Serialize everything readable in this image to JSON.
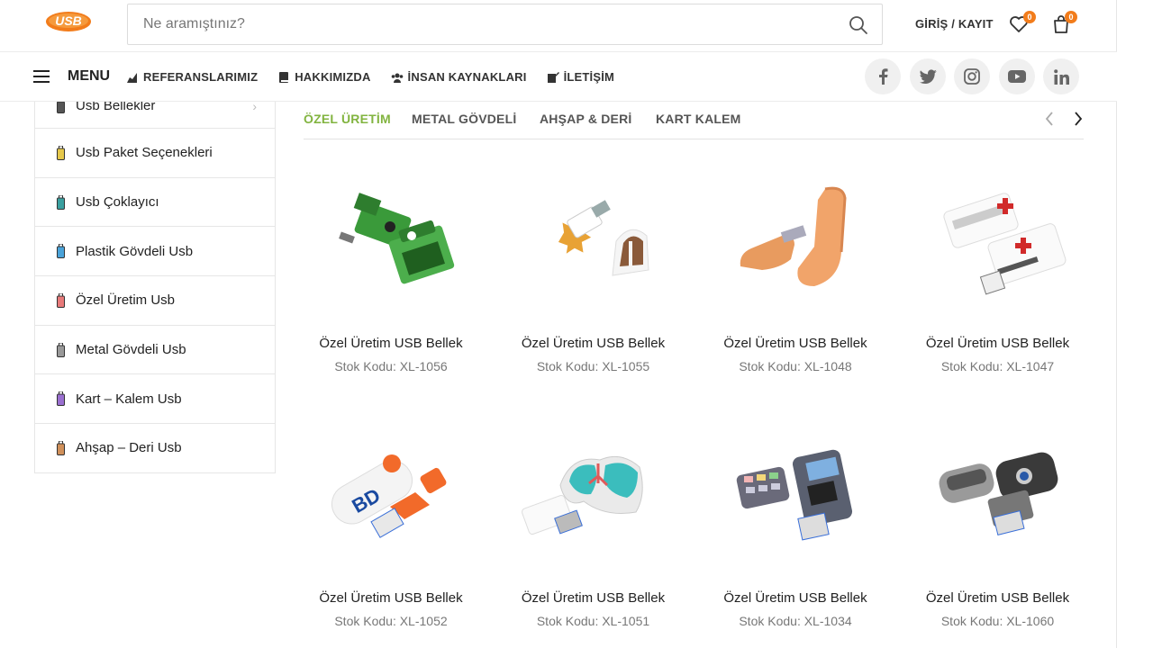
{
  "header": {
    "logo_text": "USB",
    "search_placeholder": "Ne aramıştınız?",
    "login_label": "GİRİŞ / KAYIT",
    "wishlist_count": "0",
    "cart_count": "0"
  },
  "nav": {
    "menu_label": "MENU",
    "links": [
      {
        "label": "REFERANSLARIMIZ",
        "icon": "chart-icon"
      },
      {
        "label": "HAKKIMIZDA",
        "icon": "book-icon"
      },
      {
        "label": "İNSAN KAYNAKLARI",
        "icon": "users-icon"
      },
      {
        "label": "İLETİŞİM",
        "icon": "edit-icon"
      }
    ],
    "socials": [
      {
        "label": "f",
        "icon": "facebook-icon"
      },
      {
        "label": "t",
        "icon": "twitter-icon"
      },
      {
        "label": "ig",
        "icon": "instagram-icon"
      },
      {
        "label": "yt",
        "icon": "youtube-icon"
      },
      {
        "label": "in",
        "icon": "linkedin-icon"
      }
    ]
  },
  "sidebar": {
    "items": [
      {
        "label": "Usb Bellekler",
        "color": "#555555"
      },
      {
        "label": "Usb Paket Seçenekleri",
        "color": "#e6c84b"
      },
      {
        "label": "Usb Çoklayıcı",
        "color": "#3aa0a0"
      },
      {
        "label": "Plastik Gövdeli Usb",
        "color": "#4aa3d9"
      },
      {
        "label": "Özel Üretim Usb",
        "color": "#e87a7a"
      },
      {
        "label": "Metal Gövdeli Usb",
        "color": "#999999"
      },
      {
        "label": "Kart – Kalem Usb",
        "color": "#9a6fd0"
      },
      {
        "label": "Ahşap – Deri Usb",
        "color": "#d0905a"
      }
    ]
  },
  "tabs": {
    "items": [
      "ÖZEL ÜRETİM",
      "METAL GÖVDELİ",
      "AHŞAP & DERİ",
      "KART KALEM"
    ],
    "active_color": "#82b440"
  },
  "products": [
    {
      "name": "Özel Üretim USB Bellek",
      "code": "Stok Kodu: XL-1056",
      "image": "green-cash-register-usb"
    },
    {
      "name": "Özel Üretim USB Bellek",
      "code": "Stok Kodu: XL-1055",
      "image": "star-and-arch-usb"
    },
    {
      "name": "Özel Üretim USB Bellek",
      "code": "Stok Kodu: XL-1048",
      "image": "foot-shaped-usb"
    },
    {
      "name": "Özel Üretim USB Bellek",
      "code": "Stok Kodu: XL-1047",
      "image": "first-aid-kit-usb"
    },
    {
      "name": "Özel Üretim USB Bellek",
      "code": "Stok Kodu: XL-1052",
      "image": "bd-syringe-usb"
    },
    {
      "name": "Özel Üretim USB Bellek",
      "code": "Stok Kodu: XL-1051",
      "image": "lungs-usb"
    },
    {
      "name": "Özel Üretim USB Bellek",
      "code": "Stok Kodu: XL-1034",
      "image": "card-terminal-usb"
    },
    {
      "name": "Özel Üretim USB Bellek",
      "code": "Stok Kodu: XL-1060",
      "image": "car-key-usb"
    }
  ],
  "colors": {
    "accent": "#82b440",
    "brand_orange": "#f27c1b"
  }
}
